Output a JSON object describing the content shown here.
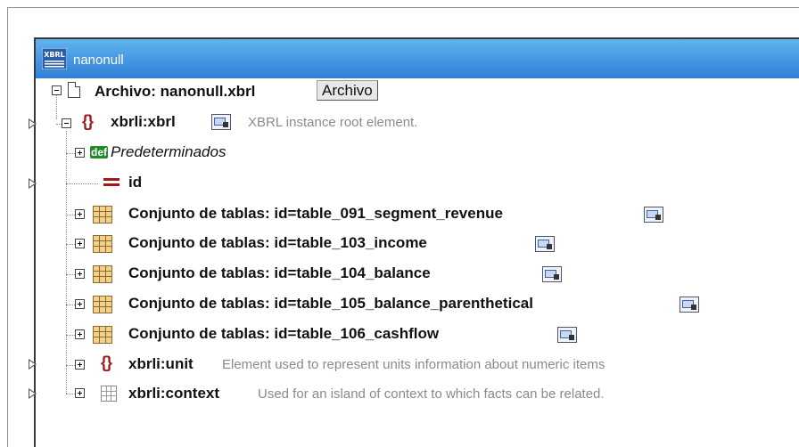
{
  "component": {
    "title": "nanonull",
    "title_icon": "xbrl-icon"
  },
  "tree": {
    "root": {
      "label": "Archivo: nanonull.xbrl",
      "button": "Archivo",
      "icon": "file-icon"
    },
    "xbrl": {
      "label": "xbrli:xbrl",
      "description": "XBRL instance root element.",
      "icon": "element-braces-icon"
    },
    "defaults": {
      "label": "Predeterminados",
      "badge": "def"
    },
    "id": {
      "label": "id",
      "icon": "attribute-icon"
    },
    "tables": [
      {
        "label": "Conjunto de tablas: id=table_091_segment_revenue"
      },
      {
        "label": "Conjunto de tablas: id=table_103_income"
      },
      {
        "label": "Conjunto de tablas: id=table_104_balance"
      },
      {
        "label": "Conjunto de tablas: id=table_105_balance_parenthetical"
      },
      {
        "label": "Conjunto de tablas: id=table_106_cashflow"
      }
    ],
    "unit": {
      "label": "xbrli:unit",
      "description": "Element used to represent units information about numeric items"
    },
    "context": {
      "label": "xbrli:context",
      "description": "Used for an island of context to which facts can be related."
    }
  },
  "colors": {
    "titlebar_top": "#61b3ef",
    "titlebar_bottom": "#2f7fd6",
    "element_icon": "#a01a1a",
    "def_badge": "#1f8b2a",
    "description_text": "#8a8a8a"
  }
}
